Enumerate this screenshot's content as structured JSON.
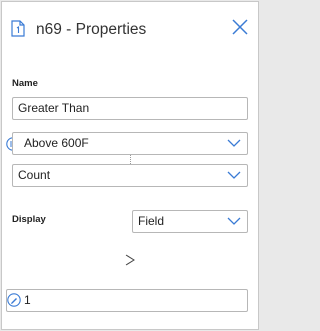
{
  "header": {
    "title": "n69 - Properties"
  },
  "form": {
    "name_label": "Name",
    "name_value": "Greater Than",
    "condition_value": "Above 600F",
    "aggregate_value": "Count",
    "display_label": "Display",
    "display_value": "Field",
    "next_arrow": ">",
    "input_value": "1"
  },
  "icons": {
    "header": "document-icon",
    "close": "close-icon",
    "condition": "list-lines-icon",
    "dropdown": "chevron-down-icon",
    "value": "pencil-icon"
  },
  "colors": {
    "accent": "#3a7bd5",
    "border": "#b7b7b7",
    "background": "#ffffff"
  }
}
